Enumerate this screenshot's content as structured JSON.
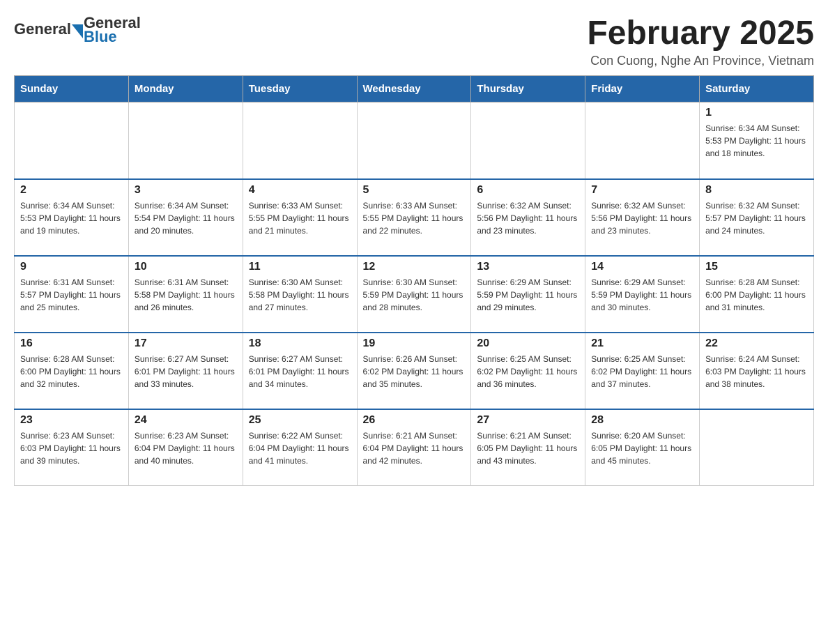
{
  "header": {
    "logo": {
      "general": "General",
      "blue": "Blue"
    },
    "title": "February 2025",
    "location": "Con Cuong, Nghe An Province, Vietnam"
  },
  "weekdays": [
    "Sunday",
    "Monday",
    "Tuesday",
    "Wednesday",
    "Thursday",
    "Friday",
    "Saturday"
  ],
  "weeks": [
    [
      {
        "day": "",
        "info": ""
      },
      {
        "day": "",
        "info": ""
      },
      {
        "day": "",
        "info": ""
      },
      {
        "day": "",
        "info": ""
      },
      {
        "day": "",
        "info": ""
      },
      {
        "day": "",
        "info": ""
      },
      {
        "day": "1",
        "info": "Sunrise: 6:34 AM\nSunset: 5:53 PM\nDaylight: 11 hours and 18 minutes."
      }
    ],
    [
      {
        "day": "2",
        "info": "Sunrise: 6:34 AM\nSunset: 5:53 PM\nDaylight: 11 hours and 19 minutes."
      },
      {
        "day": "3",
        "info": "Sunrise: 6:34 AM\nSunset: 5:54 PM\nDaylight: 11 hours and 20 minutes."
      },
      {
        "day": "4",
        "info": "Sunrise: 6:33 AM\nSunset: 5:55 PM\nDaylight: 11 hours and 21 minutes."
      },
      {
        "day": "5",
        "info": "Sunrise: 6:33 AM\nSunset: 5:55 PM\nDaylight: 11 hours and 22 minutes."
      },
      {
        "day": "6",
        "info": "Sunrise: 6:32 AM\nSunset: 5:56 PM\nDaylight: 11 hours and 23 minutes."
      },
      {
        "day": "7",
        "info": "Sunrise: 6:32 AM\nSunset: 5:56 PM\nDaylight: 11 hours and 23 minutes."
      },
      {
        "day": "8",
        "info": "Sunrise: 6:32 AM\nSunset: 5:57 PM\nDaylight: 11 hours and 24 minutes."
      }
    ],
    [
      {
        "day": "9",
        "info": "Sunrise: 6:31 AM\nSunset: 5:57 PM\nDaylight: 11 hours and 25 minutes."
      },
      {
        "day": "10",
        "info": "Sunrise: 6:31 AM\nSunset: 5:58 PM\nDaylight: 11 hours and 26 minutes."
      },
      {
        "day": "11",
        "info": "Sunrise: 6:30 AM\nSunset: 5:58 PM\nDaylight: 11 hours and 27 minutes."
      },
      {
        "day": "12",
        "info": "Sunrise: 6:30 AM\nSunset: 5:59 PM\nDaylight: 11 hours and 28 minutes."
      },
      {
        "day": "13",
        "info": "Sunrise: 6:29 AM\nSunset: 5:59 PM\nDaylight: 11 hours and 29 minutes."
      },
      {
        "day": "14",
        "info": "Sunrise: 6:29 AM\nSunset: 5:59 PM\nDaylight: 11 hours and 30 minutes."
      },
      {
        "day": "15",
        "info": "Sunrise: 6:28 AM\nSunset: 6:00 PM\nDaylight: 11 hours and 31 minutes."
      }
    ],
    [
      {
        "day": "16",
        "info": "Sunrise: 6:28 AM\nSunset: 6:00 PM\nDaylight: 11 hours and 32 minutes."
      },
      {
        "day": "17",
        "info": "Sunrise: 6:27 AM\nSunset: 6:01 PM\nDaylight: 11 hours and 33 minutes."
      },
      {
        "day": "18",
        "info": "Sunrise: 6:27 AM\nSunset: 6:01 PM\nDaylight: 11 hours and 34 minutes."
      },
      {
        "day": "19",
        "info": "Sunrise: 6:26 AM\nSunset: 6:02 PM\nDaylight: 11 hours and 35 minutes."
      },
      {
        "day": "20",
        "info": "Sunrise: 6:25 AM\nSunset: 6:02 PM\nDaylight: 11 hours and 36 minutes."
      },
      {
        "day": "21",
        "info": "Sunrise: 6:25 AM\nSunset: 6:02 PM\nDaylight: 11 hours and 37 minutes."
      },
      {
        "day": "22",
        "info": "Sunrise: 6:24 AM\nSunset: 6:03 PM\nDaylight: 11 hours and 38 minutes."
      }
    ],
    [
      {
        "day": "23",
        "info": "Sunrise: 6:23 AM\nSunset: 6:03 PM\nDaylight: 11 hours and 39 minutes."
      },
      {
        "day": "24",
        "info": "Sunrise: 6:23 AM\nSunset: 6:04 PM\nDaylight: 11 hours and 40 minutes."
      },
      {
        "day": "25",
        "info": "Sunrise: 6:22 AM\nSunset: 6:04 PM\nDaylight: 11 hours and 41 minutes."
      },
      {
        "day": "26",
        "info": "Sunrise: 6:21 AM\nSunset: 6:04 PM\nDaylight: 11 hours and 42 minutes."
      },
      {
        "day": "27",
        "info": "Sunrise: 6:21 AM\nSunset: 6:05 PM\nDaylight: 11 hours and 43 minutes."
      },
      {
        "day": "28",
        "info": "Sunrise: 6:20 AM\nSunset: 6:05 PM\nDaylight: 11 hours and 45 minutes."
      },
      {
        "day": "",
        "info": ""
      }
    ]
  ]
}
